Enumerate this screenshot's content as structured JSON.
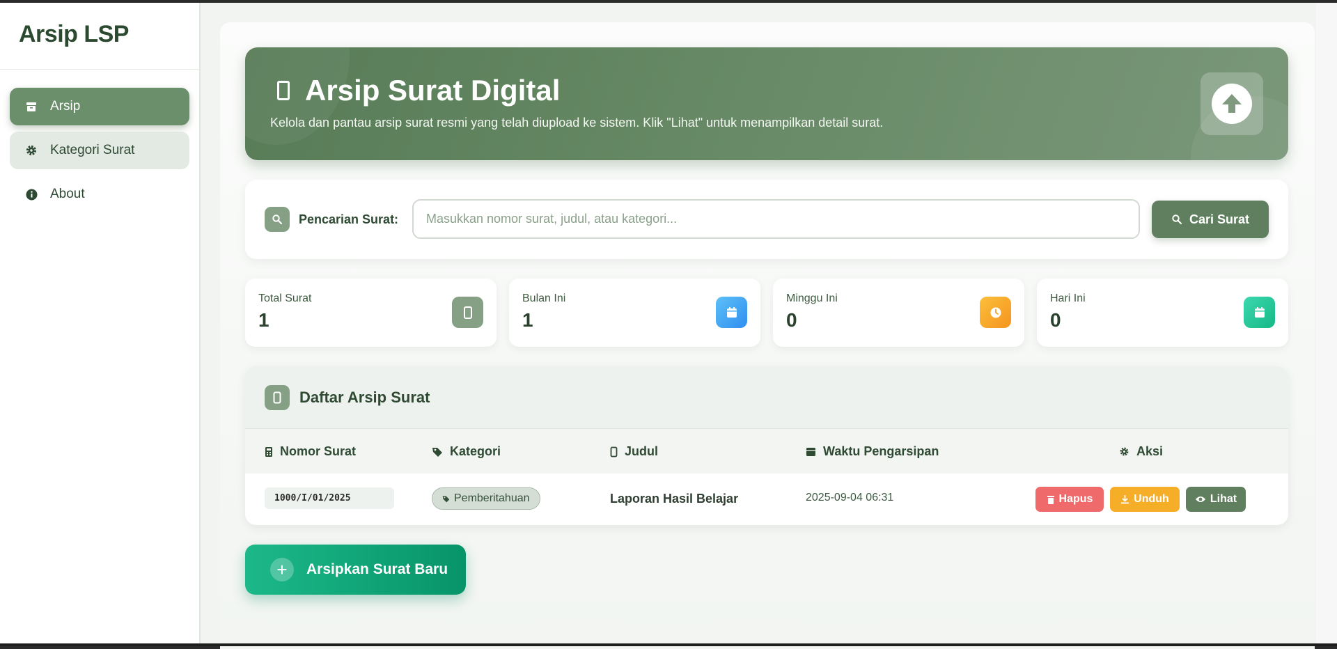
{
  "sidebar": {
    "brand": "Arsip LSP",
    "items": [
      {
        "label": "Arsip",
        "icon": "archive-icon"
      },
      {
        "label": "Kategori Surat",
        "icon": "gear-icon"
      },
      {
        "label": "About",
        "icon": "info-icon"
      }
    ]
  },
  "hero": {
    "title": "Arsip Surat Digital",
    "subtitle": "Kelola dan pantau arsip surat resmi yang telah diupload ke sistem. Klik \"Lihat\" untuk menampilkan detail surat.",
    "icon": "upload-icon"
  },
  "search": {
    "label": "Pencarian Surat:",
    "placeholder": "Masukkan nomor surat, judul, atau kategori...",
    "value": "",
    "button_label": "Cari Surat"
  },
  "stats": [
    {
      "label": "Total Surat",
      "value": "1",
      "icon": "phone-icon",
      "color": "#86a086"
    },
    {
      "label": "Bulan Ini",
      "value": "1",
      "icon": "calendar-icon",
      "color": "#3fa9f5"
    },
    {
      "label": "Minggu Ini",
      "value": "0",
      "icon": "clock-icon",
      "color": "#f6a623"
    },
    {
      "label": "Hari Ini",
      "value": "0",
      "icon": "calendar-icon",
      "color": "#26c99a"
    }
  ],
  "table": {
    "title": "Daftar Arsip Surat",
    "columns": [
      "Nomor Surat",
      "Kategori",
      "Judul",
      "Waktu Pengarsipan",
      "Aksi"
    ],
    "rows": [
      {
        "nomor": "1000/I/01/2025",
        "kategori": "Pemberitahuan",
        "judul": "Laporan Hasil Belajar",
        "waktu": "2025-09-04 06:31",
        "actions": [
          "Hapus",
          "Unduh",
          "Lihat"
        ]
      }
    ]
  },
  "new_button": "Arsipkan Surat Baru",
  "colors": {
    "primary": "#5f7f5f",
    "accent_green": "#079468",
    "danger": "#ef6a6a",
    "warning": "#f6ad28"
  }
}
